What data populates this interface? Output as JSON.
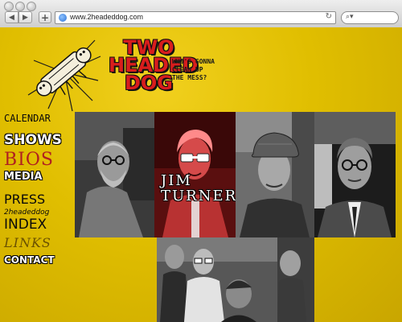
{
  "browser": {
    "url": "www.2headeddog.com",
    "reload_glyph": "↻",
    "search_glyph": "⌕▾",
    "back_glyph": "◀",
    "forward_glyph": "▶",
    "add_glyph": "+"
  },
  "site": {
    "title_lines": [
      "TWO",
      "HEADED",
      "DOG"
    ],
    "tagline_lines": [
      "WHO'S GONNA",
      "CLEAN UP",
      "THE MESS?"
    ]
  },
  "nav": {
    "calendar": "CALENDAR",
    "shows": "SHOWS",
    "bios": "BIOS",
    "media": "MEDIA",
    "press": "PRESS",
    "index_small": "2headeddog",
    "index_big": "INDEX",
    "links": "LINKS",
    "contact": "CONTACT"
  },
  "bios": {
    "highlighted_caption": [
      "JIM",
      "TURNER"
    ]
  },
  "colors": {
    "page_background": "#e0be00",
    "title_red": "#d81d1d",
    "highlight_red": "#c62828"
  }
}
